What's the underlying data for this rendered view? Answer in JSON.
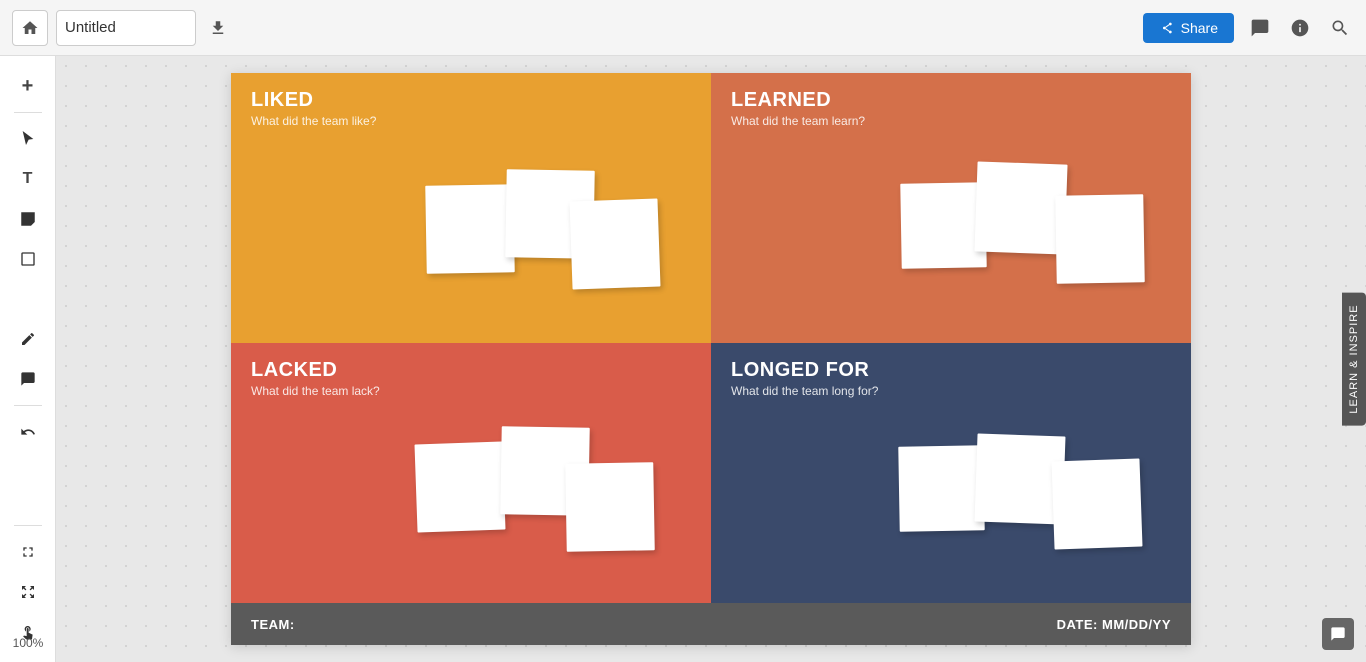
{
  "topbar": {
    "title": "Untitled",
    "share_label": "Share",
    "zoom": "100%"
  },
  "toolbar": {
    "tools": [
      {
        "name": "add",
        "icon": "+"
      },
      {
        "name": "select",
        "icon": "▲"
      },
      {
        "name": "text",
        "icon": "T"
      },
      {
        "name": "sticky",
        "icon": "▣"
      },
      {
        "name": "shape",
        "icon": "□"
      },
      {
        "name": "arrow",
        "icon": "↗"
      },
      {
        "name": "pen",
        "icon": "✏"
      },
      {
        "name": "comment",
        "icon": "💬"
      },
      {
        "name": "undo",
        "icon": "↺"
      }
    ]
  },
  "board": {
    "quadrants": [
      {
        "id": "liked",
        "title": "LIKED",
        "subtitle": "What did the team like?",
        "color": "#e8a030"
      },
      {
        "id": "learned",
        "title": "LEARNED",
        "subtitle": "What did the team learn?",
        "color": "#d4704a"
      },
      {
        "id": "lacked",
        "title": "LACKED",
        "subtitle": "What did the team lack?",
        "color": "#d95c4a"
      },
      {
        "id": "longed",
        "title": "LONGED FOR",
        "subtitle": "What did the team long for?",
        "color": "#3a4a6b"
      }
    ],
    "footer": {
      "team_label": "TEAM:",
      "date_label": "DATE: MM/DD/YY"
    }
  },
  "sidebar": {
    "label": "LEARN & INSPIRE"
  }
}
